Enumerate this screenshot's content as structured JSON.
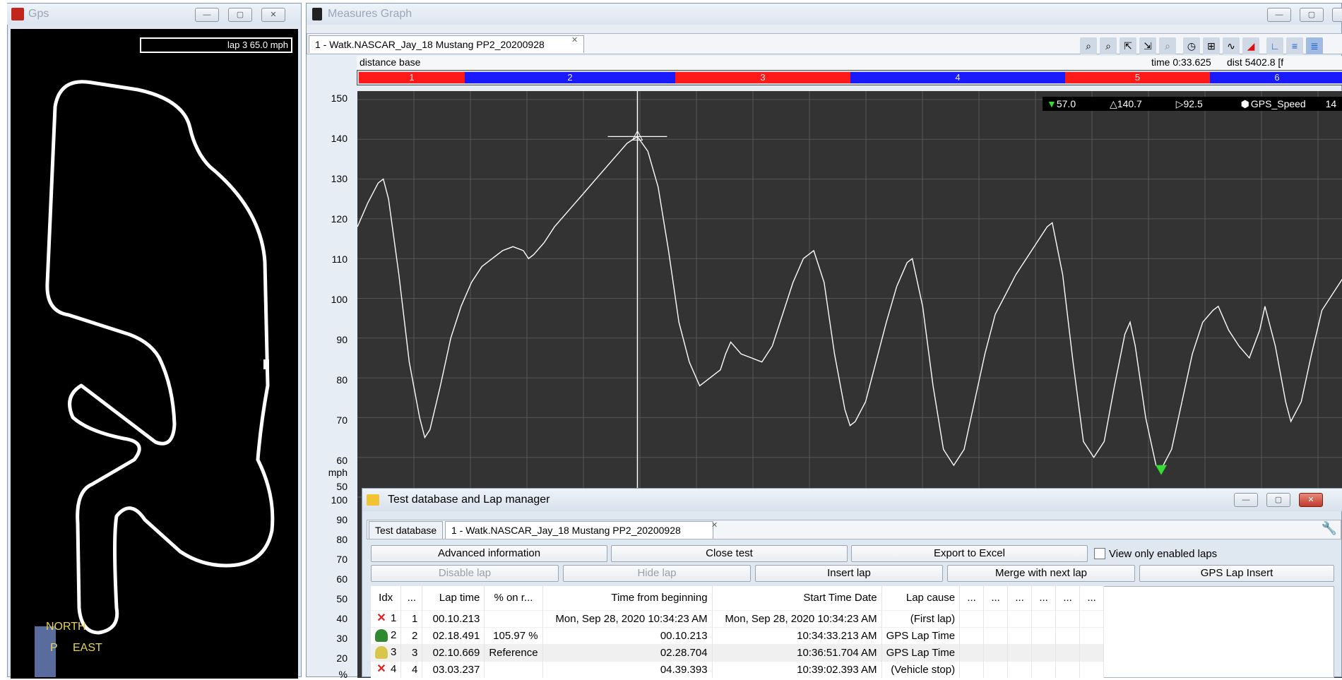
{
  "gps": {
    "title": "Gps",
    "lap_readout": "lap 3 65.0 mph",
    "compass_north": "NORTH",
    "compass_east": "EAST",
    "compass_p": "P"
  },
  "measures": {
    "title": "Measures Graph",
    "tab_label": "1 - Watk.NASCAR_Jay_18 Mustang PP2_20200928",
    "distance_base": "distance base",
    "time_readout": "time 0:33.625",
    "dist_readout": "dist 5402.8 [f",
    "sectors": [
      "1",
      "2",
      "3",
      "4",
      "5",
      "6"
    ],
    "legend_min": "57.0",
    "legend_max": "140.7",
    "legend_avg": "92.5",
    "legend_channel": "GPS_Speed",
    "legend_value": "14",
    "y_unit": "mph",
    "y_ticks": [
      "150",
      "140",
      "130",
      "120",
      "110",
      "100",
      "90",
      "80",
      "70",
      "60",
      "50"
    ],
    "y2_ticks": [
      "100",
      "90",
      "80",
      "70",
      "60",
      "50",
      "40",
      "30",
      "20"
    ],
    "y2_unit": "%",
    "icons": [
      "zoom-2d-icon",
      "zoom-icon",
      "zoom-in-icon",
      "zoom-out-icon",
      "zoom-reset-icon",
      "clock-icon",
      "fit-icon",
      "curve-icon",
      "red-triangle-icon",
      "axis-l-icon",
      "axis-multi-icon",
      "axis-stack-icon"
    ]
  },
  "chart_data": {
    "type": "line",
    "ylabel": "mph",
    "ylim": [
      50,
      150
    ],
    "series": [
      {
        "name": "GPS_Speed",
        "points": [
          [
            0,
            118
          ],
          [
            2,
            124
          ],
          [
            4,
            129
          ],
          [
            5,
            130
          ],
          [
            6,
            125
          ],
          [
            8,
            106
          ],
          [
            10,
            84
          ],
          [
            12,
            70
          ],
          [
            13,
            65
          ],
          [
            14,
            67
          ],
          [
            16,
            78
          ],
          [
            18,
            90
          ],
          [
            20,
            98
          ],
          [
            22,
            104
          ],
          [
            24,
            108
          ],
          [
            26,
            110
          ],
          [
            28,
            112
          ],
          [
            30,
            113
          ],
          [
            32,
            112
          ],
          [
            33,
            110
          ],
          [
            34,
            111
          ],
          [
            36,
            114
          ],
          [
            38,
            118
          ],
          [
            40,
            121
          ],
          [
            42,
            124
          ],
          [
            44,
            127
          ],
          [
            46,
            130
          ],
          [
            48,
            133
          ],
          [
            50,
            136
          ],
          [
            52,
            139
          ],
          [
            54,
            140.7
          ],
          [
            56,
            137
          ],
          [
            58,
            128
          ],
          [
            60,
            112
          ],
          [
            62,
            94
          ],
          [
            64,
            84
          ],
          [
            66,
            78
          ],
          [
            68,
            80
          ],
          [
            70,
            82
          ],
          [
            71,
            86
          ],
          [
            72,
            89
          ],
          [
            74,
            86
          ],
          [
            76,
            85
          ],
          [
            78,
            84
          ],
          [
            80,
            88
          ],
          [
            82,
            96
          ],
          [
            84,
            104
          ],
          [
            86,
            110
          ],
          [
            88,
            112
          ],
          [
            90,
            104
          ],
          [
            92,
            86
          ],
          [
            94,
            72
          ],
          [
            95,
            68
          ],
          [
            96,
            69
          ],
          [
            98,
            74
          ],
          [
            100,
            84
          ],
          [
            102,
            94
          ],
          [
            104,
            103
          ],
          [
            106,
            109
          ],
          [
            107,
            110
          ],
          [
            109,
            98
          ],
          [
            111,
            78
          ],
          [
            113,
            62
          ],
          [
            115,
            58
          ],
          [
            117,
            62
          ],
          [
            119,
            74
          ],
          [
            121,
            86
          ],
          [
            123,
            96
          ],
          [
            125,
            101
          ],
          [
            127,
            106
          ],
          [
            129,
            110
          ],
          [
            131,
            114
          ],
          [
            133,
            118
          ],
          [
            134,
            119
          ],
          [
            136,
            106
          ],
          [
            138,
            84
          ],
          [
            140,
            64
          ],
          [
            142,
            60
          ],
          [
            144,
            64
          ],
          [
            146,
            78
          ],
          [
            148,
            91
          ],
          [
            149,
            94
          ],
          [
            150,
            88
          ],
          [
            152,
            70
          ],
          [
            154,
            58
          ],
          [
            155,
            57
          ],
          [
            157,
            62
          ],
          [
            159,
            74
          ],
          [
            161,
            86
          ],
          [
            163,
            94
          ],
          [
            165,
            97
          ],
          [
            166,
            98
          ],
          [
            168,
            92
          ],
          [
            170,
            88
          ],
          [
            172,
            85
          ],
          [
            174,
            92
          ],
          [
            175,
            98
          ],
          [
            177,
            88
          ],
          [
            179,
            74
          ],
          [
            180,
            69
          ],
          [
            182,
            74
          ],
          [
            184,
            86
          ],
          [
            186,
            97
          ],
          [
            188,
            101
          ],
          [
            190,
            105
          ]
        ]
      }
    ],
    "cursor_x": 54,
    "cursor_y": 140.7
  },
  "lap_manager": {
    "title": "Test database and Lap manager",
    "tabs": [
      "Test database",
      "1 - Watk.NASCAR_Jay_18 Mustang PP2_20200928"
    ],
    "buttons": {
      "advanced": "Advanced information",
      "close_test": "Close test",
      "export": "Export to Excel",
      "view_enabled": "View only enabled laps",
      "disable_lap": "Disable lap",
      "hide_lap": "Hide lap",
      "insert_lap": "Insert lap",
      "merge_next": "Merge with next lap",
      "gps_insert": "GPS Lap Insert"
    },
    "columns": [
      "Idx",
      "...",
      "Lap time",
      "% on r...",
      "Time from beginning",
      "Start Time Date",
      "Lap cause",
      "...",
      "...",
      "...",
      "...",
      "...",
      "..."
    ],
    "rows": [
      {
        "idx": "1",
        "n": "1",
        "lap_time": "00.10.213",
        "pct": "",
        "from_begin": "Mon, Sep 28, 2020  10:34:23 AM",
        "start": "Mon, Sep 28, 2020  10:34:23 AM",
        "cause": "(First lap)",
        "icon": "x"
      },
      {
        "idx": "2",
        "n": "2",
        "lap_time": "02.18.491",
        "pct": "105.97 %",
        "from_begin": "00.10.213",
        "start": "10:34:33.213 AM",
        "cause": "GPS Lap Time",
        "icon": "green"
      },
      {
        "idx": "3",
        "n": "3",
        "lap_time": "02.10.669",
        "pct": "Reference",
        "from_begin": "02.28.704",
        "start": "10:36:51.704 AM",
        "cause": "GPS Lap Time",
        "icon": "yellow"
      },
      {
        "idx": "4",
        "n": "4",
        "lap_time": "03.03.237",
        "pct": "",
        "from_begin": "04.39.393",
        "start": "10:39:02.393 AM",
        "cause": "(Vehicle stop)",
        "icon": "x"
      }
    ]
  }
}
